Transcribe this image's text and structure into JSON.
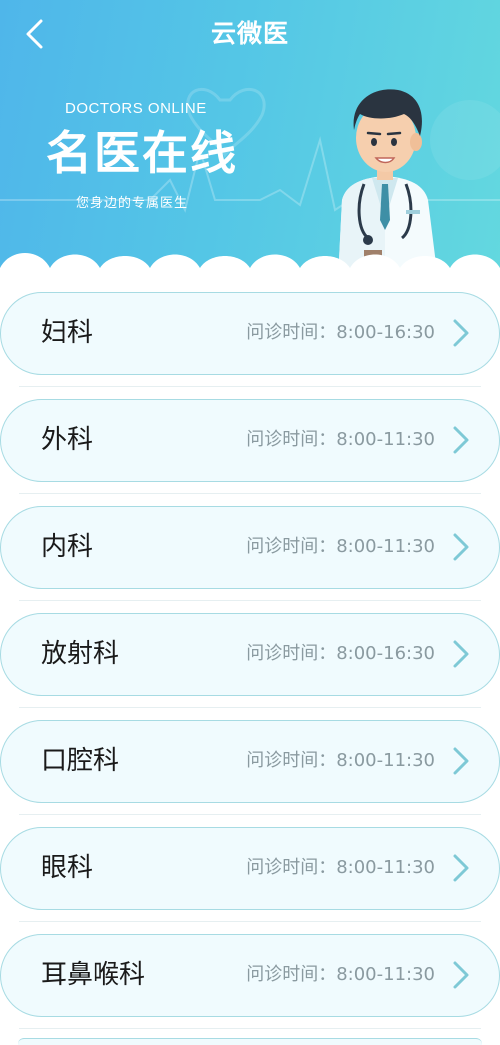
{
  "nav": {
    "title": "云微医"
  },
  "banner": {
    "en": "DOCTORS ONLINE",
    "cn": "名医在线",
    "sub": "您身边的专属医生"
  },
  "colors": {
    "header_start": "#4fb6ea",
    "header_end": "#63d8df",
    "card_bg": "#f0fbfe",
    "card_border": "#a7dbe3",
    "time_text": "#8a9aa0",
    "chevron": "#7ec9d6"
  },
  "departments": [
    {
      "name": "妇科",
      "time": "问诊时间：8:00-16:30"
    },
    {
      "name": "外科",
      "time": "问诊时间：8:00-11:30"
    },
    {
      "name": "内科",
      "time": "问诊时间：8:00-11:30"
    },
    {
      "name": "放射科",
      "time": "问诊时间：8:00-16:30"
    },
    {
      "name": "口腔科",
      "time": "问诊时间：8:00-11:30"
    },
    {
      "name": "眼科",
      "time": "问诊时间：8:00-11:30"
    },
    {
      "name": "耳鼻喉科",
      "time": "问诊时间：8:00-11:30"
    }
  ]
}
